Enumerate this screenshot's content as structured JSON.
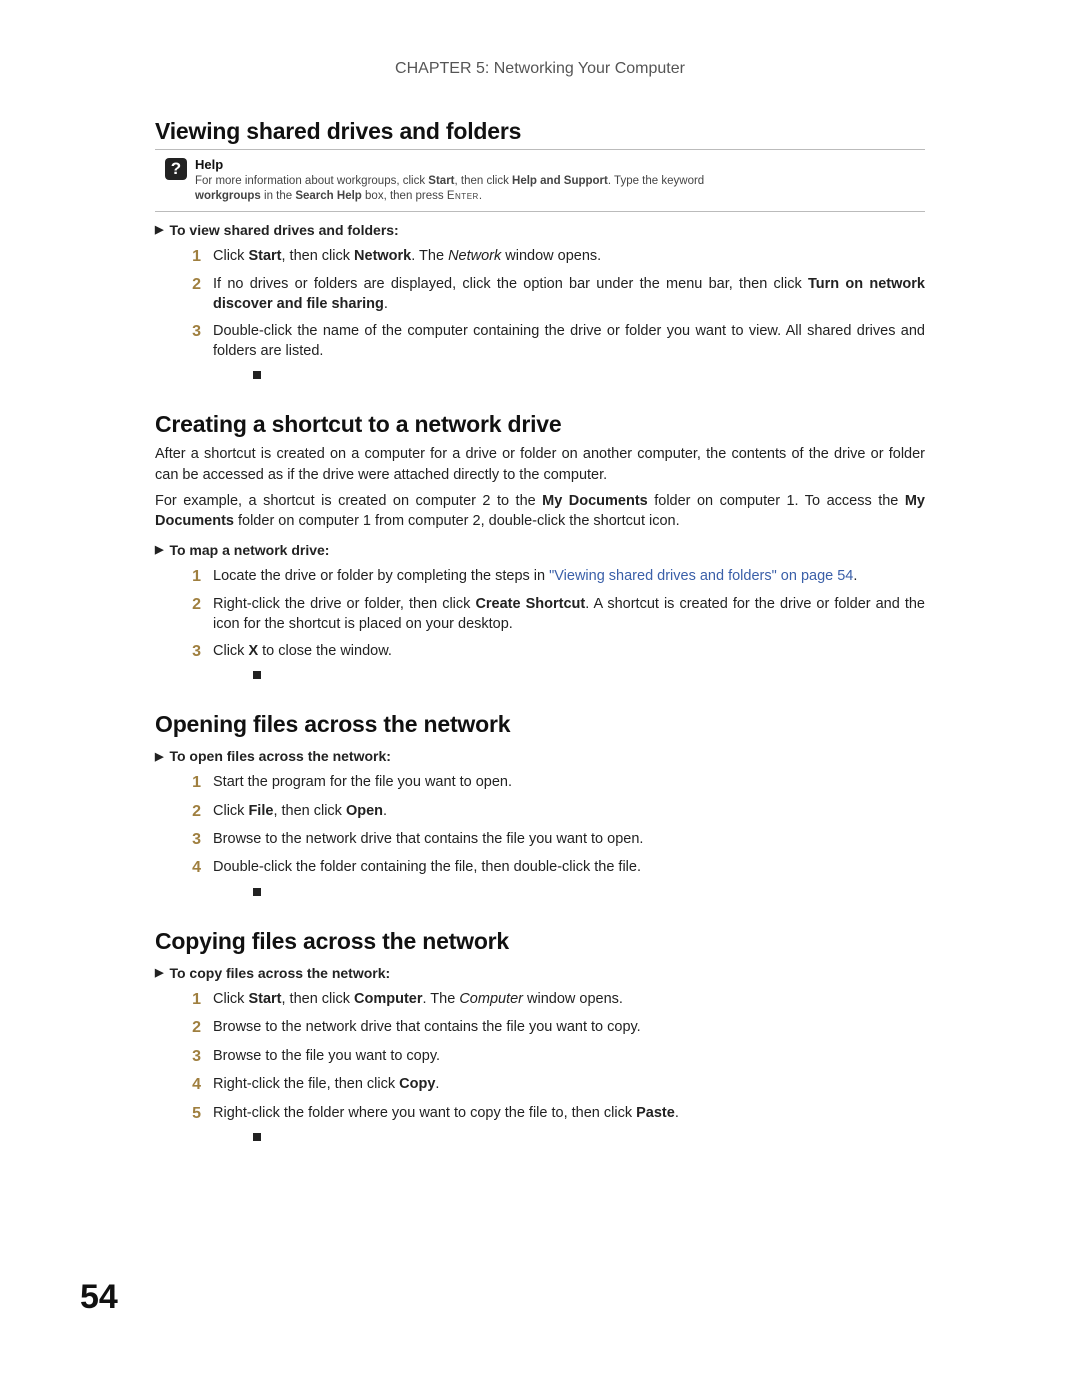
{
  "chapter_header": "CHAPTER 5: Networking Your Computer",
  "page_number": "54",
  "section1": {
    "heading": "Viewing shared drives and folders",
    "help": {
      "title": "Help",
      "line1_pre": "For more information about workgroups, click ",
      "start": "Start",
      "line1_mid": ", then click ",
      "help_support": "Help and Support",
      "line1_post": ". Type the keyword ",
      "kw": "workgroups",
      "line2_mid": " in the ",
      "search_help": "Search Help",
      "line2_post": " box, then press ",
      "enter": "Enter",
      "period": "."
    },
    "subhead": "To view shared drives and folders:",
    "s1": {
      "t1": "Click ",
      "b1": "Start",
      "t2": ", then click ",
      "b2": "Network",
      "t3": ". The ",
      "i1": "Network",
      "t4": " window opens."
    },
    "s2": {
      "t1": "If no drives or folders are displayed, click the option bar under the menu bar, then click ",
      "b1": "Turn on network discover and file sharing",
      "t2": "."
    },
    "s3": {
      "t1": "Double-click the name of the computer containing the drive or folder you want to view. All shared drives and folders are listed."
    }
  },
  "section2": {
    "heading": "Creating a shortcut to a network drive",
    "p1": "After a shortcut is created on a computer for a drive or folder on another computer, the contents of the drive or folder can be accessed as if the drive were attached directly to the computer.",
    "p2": {
      "t1": "For example, a shortcut is created on computer 2 to the ",
      "b1": "My Documents",
      "t2": " folder on computer 1. To access the ",
      "b2": "My Documents",
      "t3": " folder on computer 1 from computer 2, double-click the shortcut icon."
    },
    "subhead": "To map a network drive:",
    "s1": {
      "t1": "Locate the drive or folder by completing the steps in ",
      "link": "\"Viewing shared drives and folders\" on page 54",
      "t2": "."
    },
    "s2": {
      "t1": "Right-click the drive or folder, then click ",
      "b1": "Create Shortcut",
      "t2": ". A shortcut is created for the drive or folder and the icon for the shortcut is placed on your desktop."
    },
    "s3": {
      "t1": "Click ",
      "b1": "X",
      "t2": " to close the window."
    }
  },
  "section3": {
    "heading": "Opening files across the network",
    "subhead": "To open files across the network:",
    "s1": {
      "t1": "Start the program for the file you want to open."
    },
    "s2": {
      "t1": "Click ",
      "b1": "File",
      "t2": ", then click ",
      "b2": "Open",
      "t3": "."
    },
    "s3": {
      "t1": "Browse to the network drive that contains the file you want to open."
    },
    "s4": {
      "t1": "Double-click the folder containing the file, then double-click the file."
    }
  },
  "section4": {
    "heading": "Copying files across the network",
    "subhead": "To copy files across the network:",
    "s1": {
      "t1": "Click ",
      "b1": "Start",
      "t2": ", then click ",
      "b2": "Computer",
      "t3": ". The ",
      "i1": "Computer",
      "t4": " window opens."
    },
    "s2": {
      "t1": "Browse to the network drive that contains the file you want to copy."
    },
    "s3": {
      "t1": "Browse to the file you want to copy."
    },
    "s4": {
      "t1": "Right-click the file, then click ",
      "b1": "Copy",
      "t2": "."
    },
    "s5": {
      "t1": "Right-click the folder where you want to copy the file to, then click ",
      "b1": "Paste",
      "t2": "."
    }
  }
}
